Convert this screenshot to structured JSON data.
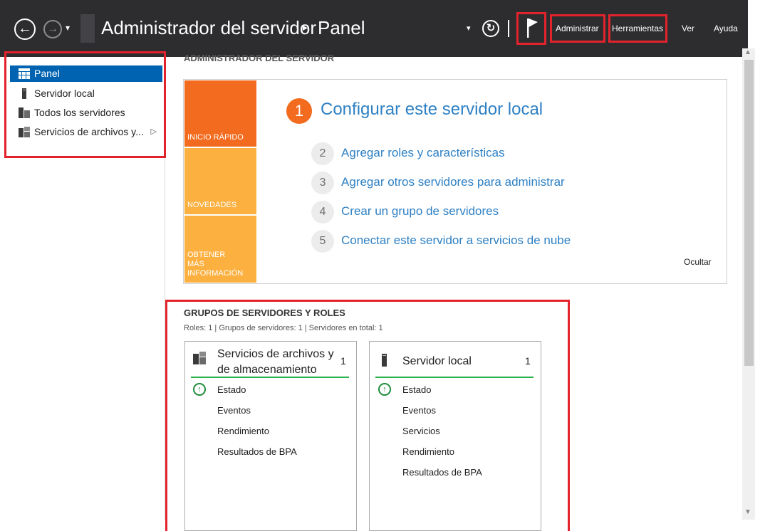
{
  "titlebar": {
    "app_title": "Administrador del servidor",
    "page": "Panel",
    "menu": [
      "Administrar",
      "Herramientas",
      "Ver",
      "Ayuda"
    ]
  },
  "sidebar": {
    "items": [
      {
        "label": "Panel",
        "icon": "dashboard-icon"
      },
      {
        "label": "Servidor local",
        "icon": "server-icon"
      },
      {
        "label": "Todos los servidores",
        "icon": "servers-icon"
      },
      {
        "label": "Servicios de archivos y...",
        "icon": "file-services-icon"
      }
    ]
  },
  "main": {
    "section_title": "ADMINISTRADOR DEL SERVIDOR",
    "quick_start": {
      "tabs": [
        "INICIO RÁPIDO",
        "NOVEDADES",
        "OBTENER MÁS INFORMACIÓN"
      ],
      "steps": [
        {
          "num": "1",
          "label": "Configurar este servidor local"
        },
        {
          "num": "2",
          "label": "Agregar roles y características"
        },
        {
          "num": "3",
          "label": "Agregar otros servidores para administrar"
        },
        {
          "num": "4",
          "label": "Crear un grupo de servidores"
        },
        {
          "num": "5",
          "label": "Conectar este servidor a servicios de nube"
        }
      ],
      "hide": "Ocultar"
    },
    "groups": {
      "title": "GRUPOS DE SERVIDORES Y ROLES",
      "subtitle": "Roles: 1   |   Grupos de servidores: 1   |   Servidores en total: 1",
      "cards": [
        {
          "title_line1": "Servicios de archivos y",
          "title_line2": "de almacenamiento",
          "count": "1",
          "rows": [
            "Estado",
            "Eventos",
            "Rendimiento",
            "Resultados de BPA"
          ]
        },
        {
          "title_line1": "Servidor local",
          "count": "1",
          "rows": [
            "Estado",
            "Eventos",
            "Servicios",
            "Rendimiento",
            "Resultados de BPA"
          ]
        }
      ]
    }
  },
  "colors": {
    "titlebar": "#2d2d30",
    "accent_blue": "#0063b1",
    "link_blue": "#2e80c4",
    "orange": "#f26b1e",
    "amber": "#fbb040",
    "highlight_red": "#e3232c",
    "status_green": "#2bb24c"
  }
}
